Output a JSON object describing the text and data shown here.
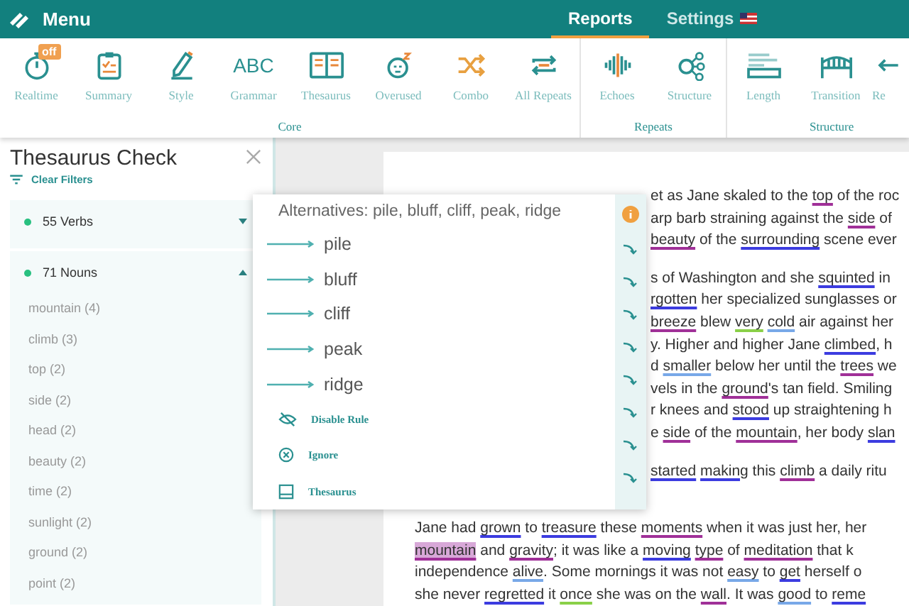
{
  "top_bar": {
    "menu_label": "Menu",
    "tabs": [
      {
        "label": "Reports",
        "selected": true,
        "flag": false
      },
      {
        "label": "Settings",
        "selected": false,
        "flag": true
      }
    ]
  },
  "toolbar": {
    "groups": [
      {
        "label": "Core",
        "tools": [
          {
            "label": "Realtime",
            "kind": "stopwatch",
            "badge": "off"
          },
          {
            "label": "Summary",
            "kind": "clipboard"
          },
          {
            "label": "Style",
            "kind": "pen"
          },
          {
            "label": "Grammar",
            "kind": "abc",
            "icon_text": "ABC"
          },
          {
            "label": "Thesaurus",
            "kind": "book"
          },
          {
            "label": "Overused",
            "kind": "sleepy"
          },
          {
            "label": "Combo",
            "kind": "shuffle"
          },
          {
            "label": "All Repeats",
            "kind": "repeat"
          }
        ]
      },
      {
        "label": "Repeats",
        "tools": [
          {
            "label": "Echoes",
            "kind": "wave"
          },
          {
            "label": "Structure",
            "kind": "nodes"
          }
        ]
      },
      {
        "label": "Structure",
        "tools": [
          {
            "label": "Length",
            "kind": "ruler"
          },
          {
            "label": "Transition",
            "kind": "bridge"
          },
          {
            "label": "Re",
            "kind": "arrow"
          }
        ]
      }
    ]
  },
  "sidebar": {
    "title": "Thesaurus Check",
    "clear_filters": "Clear Filters",
    "groups": [
      {
        "label": "55 Verbs",
        "expanded": false
      },
      {
        "label": "71 Nouns",
        "expanded": true,
        "items": [
          "mountain (4)",
          "climb (3)",
          "top (2)",
          "side (2)",
          "head (2)",
          "beauty (2)",
          "time (2)",
          "sunlight (2)",
          "ground (2)",
          "point (2)"
        ]
      }
    ]
  },
  "popup": {
    "title": "Alternatives: pile, bluff, cliff, peak, ridge",
    "alternatives": [
      "pile",
      "bluff",
      "cliff",
      "peak",
      "ridge"
    ],
    "actions": [
      {
        "label": "Disable Rule",
        "kind": "hide"
      },
      {
        "label": "Ignore",
        "kind": "ignore"
      },
      {
        "label": "Thesaurus",
        "kind": "book"
      }
    ]
  },
  "document": {
    "upper_paragraphs": [
      [
        [
          {
            "text": "et as Jane skaled to the "
          },
          {
            "text": "top",
            "kind": "noun"
          },
          {
            "text": " of the roc"
          }
        ],
        [
          {
            "text": "arp barb straining against the "
          },
          {
            "text": "side",
            "kind": "noun"
          },
          {
            "text": " of"
          }
        ],
        [
          {
            "text": "beauty",
            "kind": "noun"
          },
          {
            "text": " of the "
          },
          {
            "text": "surrounding",
            "kind": "verb"
          },
          {
            "text": " scene ever"
          }
        ]
      ],
      [
        [
          {
            "text": "s of Washington and she "
          },
          {
            "text": "squinted",
            "kind": "verb"
          },
          {
            "text": " in"
          }
        ],
        [
          {
            "text": "rgotten",
            "kind": "verb"
          },
          {
            "text": " her specialized sunglasses or"
          }
        ],
        [
          {
            "text": "breeze",
            "kind": "noun"
          },
          {
            "text": " blew "
          },
          {
            "text": "very",
            "kind": "adverb"
          },
          {
            "text": "cold",
            "kind": "adjective"
          },
          {
            "text": " air against her"
          }
        ],
        [
          {
            "text": "y. Higher and higher Jane "
          },
          {
            "text": "climbed",
            "kind": "verb"
          },
          {
            "text": ", h"
          }
        ],
        [
          {
            "text": "d "
          },
          {
            "text": "smaller",
            "kind": "adjective"
          },
          {
            "text": " below her until the "
          },
          {
            "text": "trees",
            "kind": "noun"
          },
          {
            "text": " we"
          }
        ],
        [
          {
            "text": "vels in the "
          },
          {
            "text": "ground",
            "kind": "noun"
          },
          {
            "text": "'s tan field. Smiling"
          }
        ],
        [
          {
            "text": "r knees and "
          },
          {
            "text": "stood",
            "kind": "verb"
          },
          {
            "text": " up straightening h"
          }
        ],
        [
          {
            "text": "e "
          },
          {
            "text": "side",
            "kind": "noun"
          },
          {
            "text": " of the "
          },
          {
            "text": "mountain",
            "kind": "noun"
          },
          {
            "text": ", her body "
          },
          {
            "text": "slan",
            "kind": "verb"
          }
        ]
      ],
      [
        [
          {
            "text": "started",
            "kind": "verb"
          },
          {
            "text": "making",
            "kind": "verb"
          },
          {
            "text": " this "
          },
          {
            "text": "climb",
            "kind": "noun"
          },
          {
            "text": " a daily ritu"
          }
        ]
      ]
    ],
    "lower_lines": [
      [
        {
          "text": "Jane had "
        },
        {
          "text": "grown",
          "kind": "verb"
        },
        {
          "text": " to "
        },
        {
          "text": "treasure",
          "kind": "verb"
        },
        {
          "text": " these "
        },
        {
          "text": "moments",
          "kind": "noun"
        },
        {
          "text": " when it was just her, her"
        }
      ],
      [
        {
          "text": "mountain",
          "kind": "active-noun"
        },
        {
          "text": " and "
        },
        {
          "text": "gravity",
          "kind": "noun"
        },
        {
          "text": "; it was like a "
        },
        {
          "text": "moving",
          "kind": "verb"
        },
        {
          "text": "type",
          "kind": "noun"
        },
        {
          "text": " of "
        },
        {
          "text": "meditation",
          "kind": "noun"
        },
        {
          "text": " that k"
        }
      ],
      [
        {
          "text": "independence "
        },
        {
          "text": "alive",
          "kind": "adjective"
        },
        {
          "text": ". Some mornings it was not "
        },
        {
          "text": "easy",
          "kind": "adjective"
        },
        {
          "text": " to "
        },
        {
          "text": "get",
          "kind": "verb"
        },
        {
          "text": " herself o"
        }
      ],
      [
        {
          "text": "she never "
        },
        {
          "text": "regretted",
          "kind": "verb"
        },
        {
          "text": " it "
        },
        {
          "text": "once",
          "kind": "adverb"
        },
        {
          "text": " she was on the "
        },
        {
          "text": "wall",
          "kind": "noun"
        },
        {
          "text": ". It was "
        },
        {
          "text": "good",
          "kind": "adjective"
        },
        {
          "text": " to "
        },
        {
          "text": "reme",
          "kind": "verb"
        }
      ]
    ]
  }
}
